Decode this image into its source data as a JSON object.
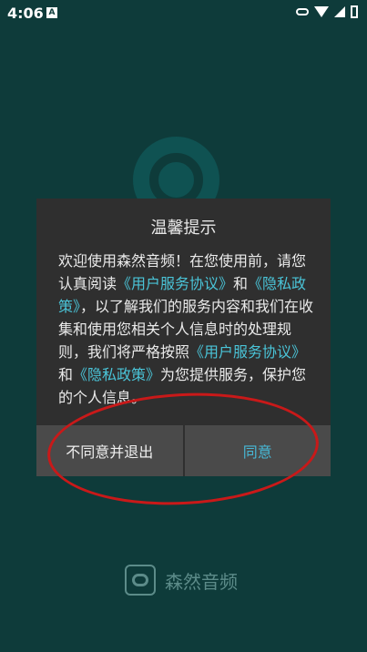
{
  "status_bar": {
    "time": "4:06",
    "notification_icon_label": "A",
    "icons": [
      "key-icon",
      "wifi-icon",
      "signal-icon",
      "battery-icon"
    ]
  },
  "dialog": {
    "title": "温馨提示",
    "body_parts": [
      "欢迎使用森然音频！在您使用前，请您认真阅读",
      "《用户服务协议》",
      "和",
      "《隐私政策》",
      "，以了解我们的服务内容和我们在收集和使用您相关个人信息时的处理规则，我们将严格按照",
      "《用户服务协议》",
      "和",
      "《隐私政策》",
      "为您提供服务，保护您的个人信息。"
    ],
    "buttons": {
      "disagree": "不同意并退出",
      "agree": "同意"
    }
  },
  "brand": {
    "name": "森然音频"
  },
  "colors": {
    "background": "#0e3b3a",
    "dialog": "#2f2f2f",
    "link": "#4ac4d8",
    "annotation": "#c91919"
  }
}
